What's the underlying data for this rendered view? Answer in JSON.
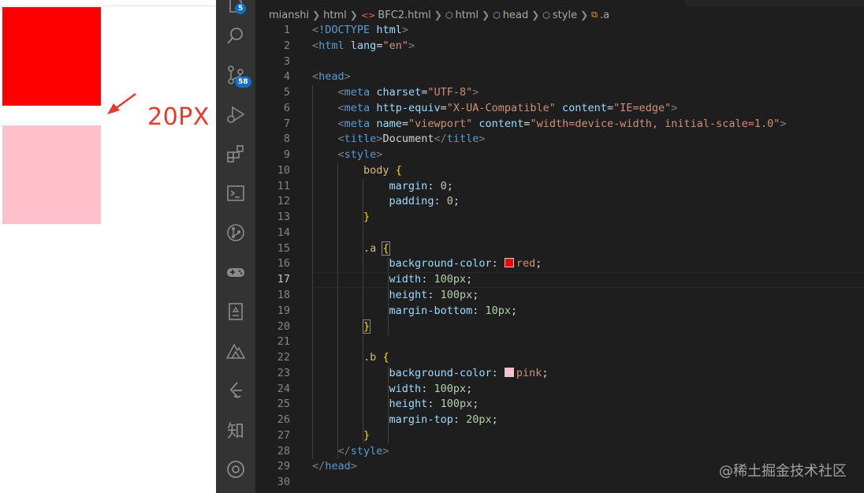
{
  "preview": {
    "annotation": "20PX",
    "box_a_color": "#ff0000",
    "box_b_color": "#ffc0cb"
  },
  "activity": {
    "items": [
      {
        "name": "explorer-icon",
        "badge": "5"
      },
      {
        "name": "search-icon",
        "badge": ""
      },
      {
        "name": "source-control-icon",
        "badge": "58"
      },
      {
        "name": "run-debug-icon",
        "badge": ""
      },
      {
        "name": "extensions-icon",
        "badge": ""
      },
      {
        "name": "terminal-icon",
        "badge": ""
      },
      {
        "name": "git-graph-icon",
        "badge": ""
      },
      {
        "name": "gamepad-icon",
        "badge": ""
      },
      {
        "name": "book-icon",
        "badge": ""
      },
      {
        "name": "mountain-icon",
        "badge": ""
      },
      {
        "name": "leetcode-icon",
        "badge": ""
      },
      {
        "name": "zhihu-icon",
        "badge": "",
        "text": "知"
      },
      {
        "name": "settings-circle-icon",
        "badge": ""
      }
    ]
  },
  "breadcrumb": {
    "items": [
      "mianshi",
      "html",
      "BFC2.html",
      "html",
      "head",
      "style",
      ".a"
    ]
  },
  "editor": {
    "current_line": 17,
    "lines": [
      "1",
      "2",
      "3",
      "4",
      "5",
      "6",
      "7",
      "8",
      "9",
      "10",
      "11",
      "12",
      "13",
      "14",
      "15",
      "16",
      "17",
      "18",
      "19",
      "20",
      "21",
      "22",
      "23",
      "24",
      "25",
      "26",
      "27",
      "28",
      "29",
      "30"
    ],
    "code": {
      "doctype": "!DOCTYPE",
      "doctype_kw": "html",
      "html_tag": "html",
      "lang_attr": "lang",
      "lang_val": "\"en\"",
      "head_tag": "head",
      "meta_tag": "meta",
      "charset_attr": "charset",
      "charset_val": "\"UTF-8\"",
      "http_equiv_attr": "http-equiv",
      "http_equiv_val": "\"X-UA-Compatible\"",
      "content_attr": "content",
      "content_val1": "\"IE=edge\"",
      "name_attr": "name",
      "name_val": "\"viewport\"",
      "content_val2": "\"width=device-width, initial-scale=1.0\"",
      "title_tag": "title",
      "title_text": "Document",
      "style_tag": "style",
      "sel_body": "body",
      "prop_margin": "margin",
      "val_0": "0",
      "prop_padding": "padding",
      "sel_a": ".a",
      "prop_bg": "background-color",
      "val_red": "red",
      "prop_width": "width",
      "val_100px": "100px",
      "prop_height": "height",
      "prop_margin_bottom": "margin-bottom",
      "val_10px": "10px",
      "sel_b": ".b",
      "val_pink": "pink",
      "prop_margin_top": "margin-top",
      "val_20px": "20px"
    },
    "swatch_red": "#ff0000",
    "swatch_pink": "#ffc0cb"
  },
  "watermark": "@稀土掘金技术社区"
}
